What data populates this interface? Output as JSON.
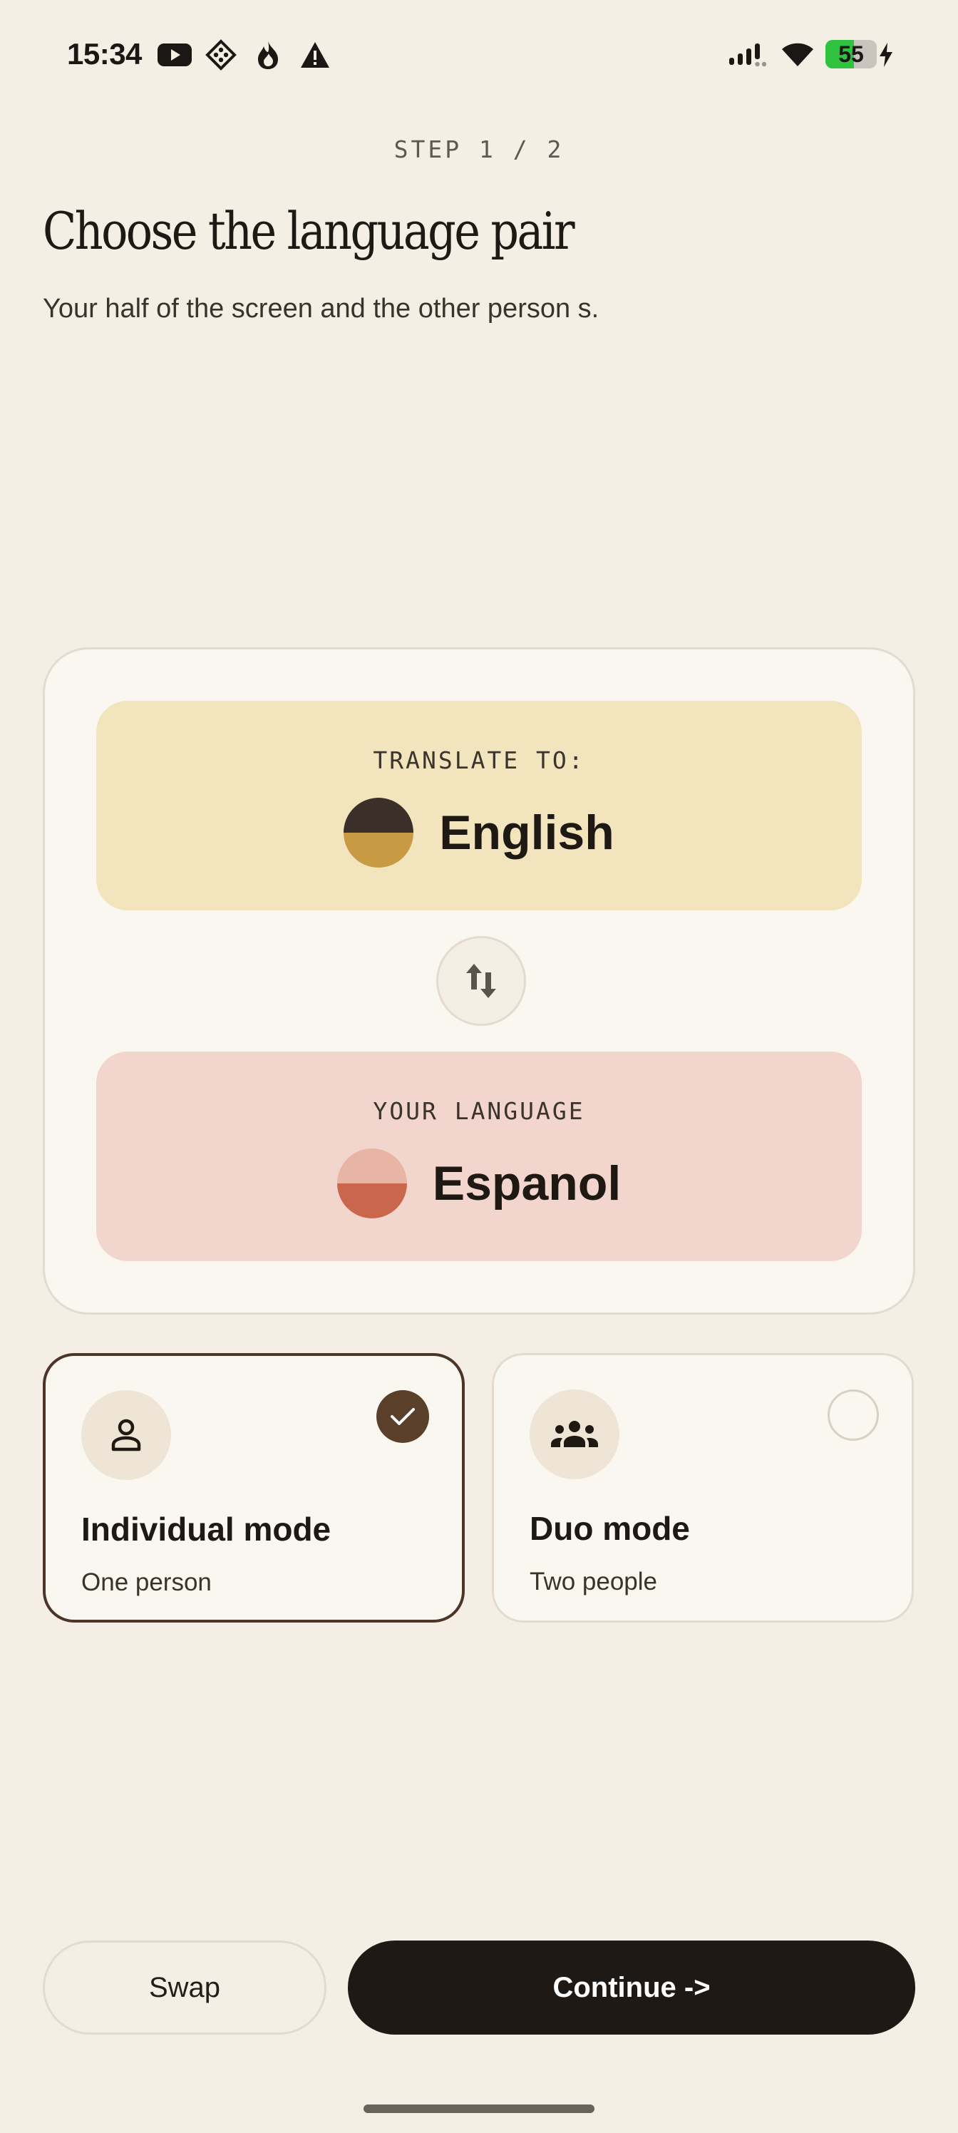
{
  "status_bar": {
    "time": "15:34",
    "icons": [
      "youtube-icon",
      "app-grid-icon",
      "fire-icon",
      "warning-icon",
      "signal-icon",
      "wifi-icon"
    ],
    "battery_level": "55",
    "battery_color": "#2ec23f"
  },
  "header": {
    "step": "STEP 1 / 2",
    "title": "Choose the language pair",
    "subtitle": "Your half of the screen and the other person s."
  },
  "language_card": {
    "target": {
      "label": "TRANSLATE TO:",
      "language": "English",
      "colors": [
        "#3b2f29",
        "#c99a44"
      ],
      "panel_color": "#f2e4bd"
    },
    "swap_icon": "swap-vertical-icon",
    "source": {
      "label": "YOUR LANGUAGE",
      "language": "Espanol",
      "colors": [
        "#e8b4a3",
        "#c9664b"
      ],
      "panel_color": "#f2d5cc"
    }
  },
  "modes": [
    {
      "title": "Individual mode",
      "subtitle": "One person",
      "selected": true,
      "icon": "person-icon"
    },
    {
      "title": "Duo mode",
      "subtitle": "Two people",
      "selected": false,
      "icon": "group-icon"
    }
  ],
  "actions": {
    "swap_label": "Swap",
    "continue_label": "Continue ->"
  },
  "colors": {
    "background": "#f4eee5",
    "accent_dark": "#1e1914",
    "selected_border": "#4a3526"
  }
}
